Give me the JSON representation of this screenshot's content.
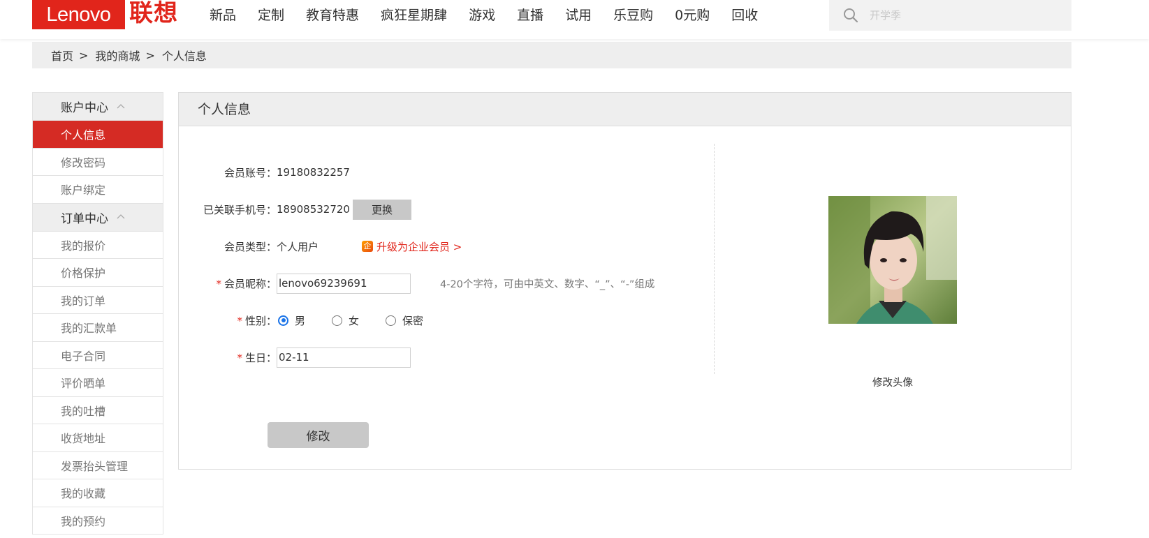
{
  "header": {
    "logo_en": "Lenovo",
    "logo_cn": "联想",
    "brand_color": "#e1251b",
    "nav": [
      "新品",
      "定制",
      "教育特惠",
      "疯狂星期肆",
      "游戏",
      "直播",
      "试用",
      "乐豆购",
      "0元购",
      "回收"
    ],
    "search": {
      "placeholder": "开学季",
      "icon": "search-icon"
    }
  },
  "breadcrumb": {
    "items": [
      "首页",
      "我的商城"
    ],
    "separator": ">",
    "current": "个人信息"
  },
  "sidebar": {
    "groups": [
      {
        "title": "账户中心",
        "items": [
          "个人信息",
          "修改密码",
          "账户绑定"
        ]
      },
      {
        "title": "订单中心",
        "items": [
          "我的报价",
          "价格保护",
          "我的订单",
          "我的汇款单",
          "电子合同",
          "评价晒单",
          "我的吐槽",
          "收货地址",
          "发票抬头管理",
          "我的收藏",
          "我的预约"
        ]
      }
    ],
    "active_item": "个人信息",
    "active_color": "#d52b24"
  },
  "panel": {
    "title": "个人信息",
    "fields": {
      "account": {
        "label": "会员账号：",
        "value": "19180832257"
      },
      "phone": {
        "label": "已关联手机号：",
        "value": "18908532720",
        "button": "更换"
      },
      "member_type": {
        "label": "会员类型：",
        "value": "个人用户",
        "upgrade_icon": "企",
        "upgrade_label": "升级为企业会员 >"
      },
      "nickname": {
        "required": "*",
        "label": "会员昵称：",
        "value": "lenovo69239691",
        "hint": "4-20个字符，可由中英文、数字、“_”、“-”组成"
      },
      "gender": {
        "required": "*",
        "label": "性别：",
        "options": [
          "男",
          "女",
          "保密"
        ],
        "selected": "男"
      },
      "birthday": {
        "required": "*",
        "label": "生日：",
        "value": "02-11"
      }
    },
    "submit_label": "修改",
    "avatar_edit_label": "修改头像"
  }
}
